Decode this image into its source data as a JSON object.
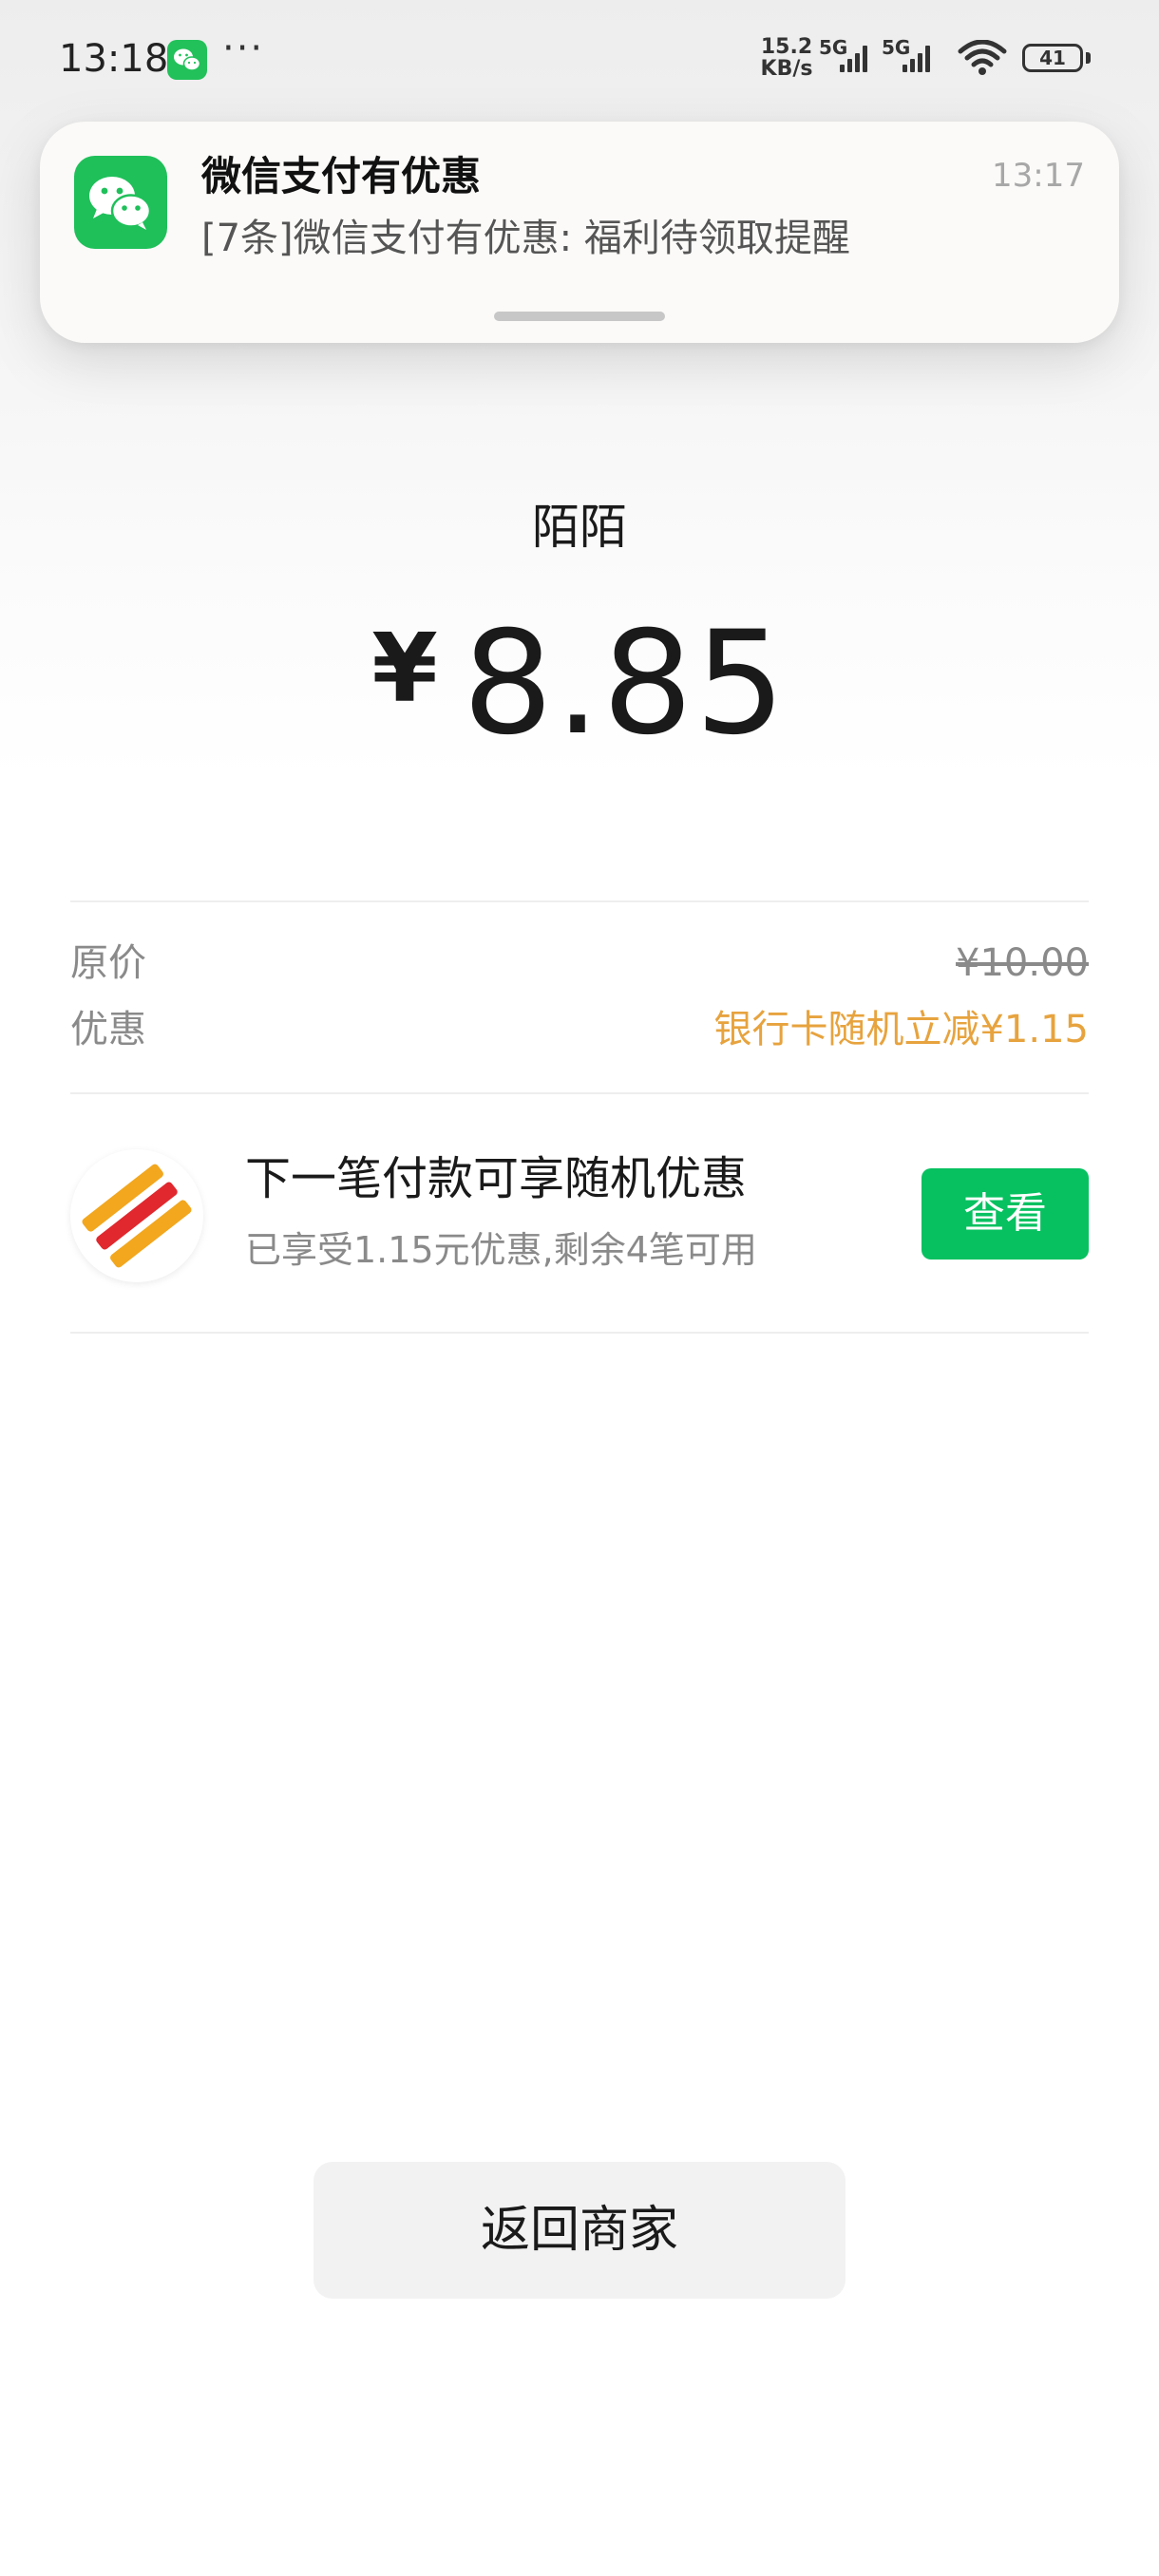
{
  "status_bar": {
    "time": "13:18",
    "more": "···",
    "net_speed_value": "15.2",
    "net_speed_unit": "KB/s",
    "signal_1_label": "5G",
    "signal_2_label": "5G",
    "battery_level": "41"
  },
  "notification": {
    "app_name": "微信支付有优惠",
    "time": "13:17",
    "body": "[7条]微信支付有优惠: 福利待领取提醒"
  },
  "payment": {
    "payee": "陌陌",
    "currency_symbol": "¥",
    "amount": "8.85"
  },
  "details": {
    "original_label": "原价",
    "original_value": "¥10.00",
    "discount_label": "优惠",
    "discount_value": "银行卡随机立减¥1.15"
  },
  "promo": {
    "title": "下一笔付款可享随机优惠",
    "subtitle": "已享受1.15元优惠,剩余4笔可用",
    "button_label": "查看"
  },
  "footer": {
    "return_label": "返回商家"
  },
  "colors": {
    "wechat_green": "#07c160",
    "discount_orange": "#e7a33e"
  }
}
